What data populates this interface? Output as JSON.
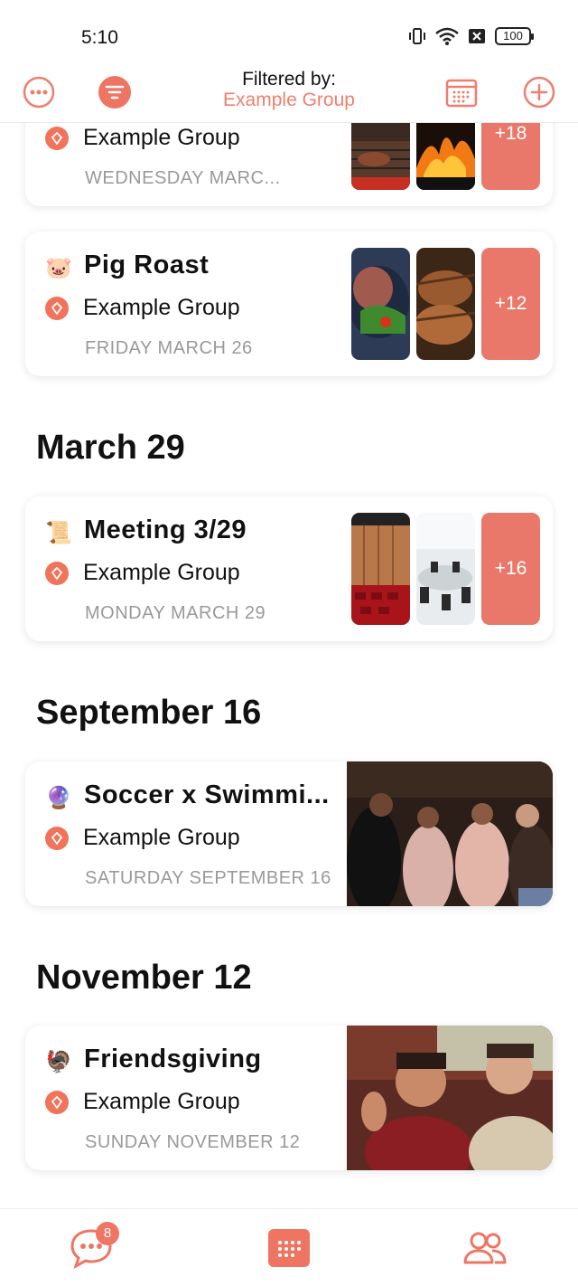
{
  "status_bar": {
    "time": "5:10",
    "battery": "100"
  },
  "header": {
    "filtered_label": "Filtered by:",
    "filter_value": "Example Group",
    "accent": "#ee7f6f"
  },
  "sections": [
    {
      "title": "March 29"
    },
    {
      "title": "September 16"
    },
    {
      "title": "November 12"
    }
  ],
  "events": [
    {
      "emoji": "",
      "title": "",
      "group": "Example Group",
      "date": "WEDNESDAY MARC...",
      "more_count": "+18"
    },
    {
      "emoji": "🐷",
      "title": "Pig Roast",
      "group": "Example Group",
      "date": "FRIDAY MARCH 26",
      "more_count": "+12"
    },
    {
      "emoji": "📜",
      "title": "Meeting 3/29",
      "group": "Example Group",
      "date": "MONDAY MARCH 29",
      "more_count": "+16"
    },
    {
      "emoji": "🔮",
      "title": "Soccer x Swimmi...",
      "group": "Example Group",
      "date": "SATURDAY SEPTEMBER 16"
    },
    {
      "emoji": "🦃",
      "title": "Friendsgiving",
      "group": "Example Group",
      "date": "SUNDAY NOVEMBER 12"
    }
  ],
  "bottom_nav": {
    "chat_badge": "8",
    "items": [
      "chat-icon",
      "calendar-grid-icon",
      "people-icon"
    ]
  }
}
